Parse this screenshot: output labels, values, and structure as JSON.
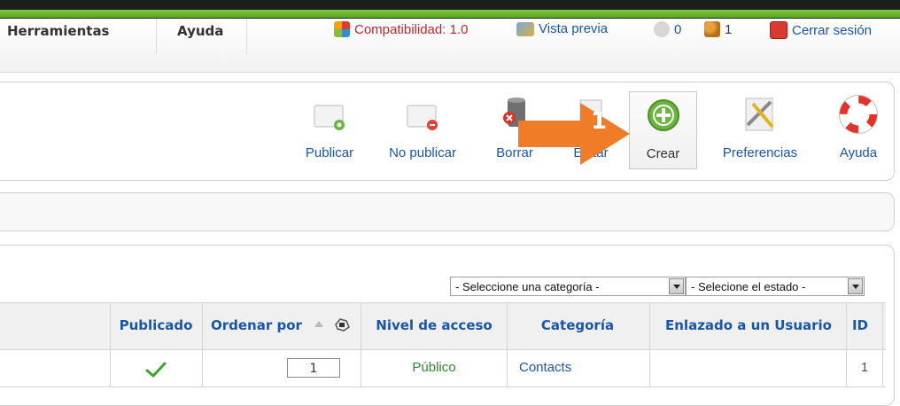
{
  "menu": {
    "items": [
      {
        "label": "Herramientas"
      },
      {
        "label": "Ayuda"
      }
    ]
  },
  "status": {
    "compatibility": "Compatibilidad: 1.0",
    "preview": "Vista previa",
    "messages_count": "0",
    "users_count": "1",
    "logout": "Cerrar sesión"
  },
  "toolbar": {
    "publish": "Publicar",
    "unpublish": "No publicar",
    "delete": "Borrar",
    "edit": "Editar",
    "new": "Crear",
    "preferences": "Preferencias",
    "help": "Ayuda"
  },
  "annotation": {
    "number": "1"
  },
  "filters": {
    "category": "- Seleccione una categoría -",
    "state": "- Selecione el estado -"
  },
  "table": {
    "headers": {
      "published": "Publicado",
      "order": "Ordenar por",
      "access": "Nivel de acceso",
      "category": "Categoría",
      "linked_user": "Enlazado a un Usuario",
      "id": "ID"
    },
    "rows": [
      {
        "order": "1",
        "access": "Público",
        "category": "Contacts",
        "linked_user": "",
        "id": "1"
      }
    ]
  },
  "colors": {
    "accent_green": "#6cb33f",
    "link_blue": "#1a56a8",
    "arrow_orange": "#f07c27"
  }
}
